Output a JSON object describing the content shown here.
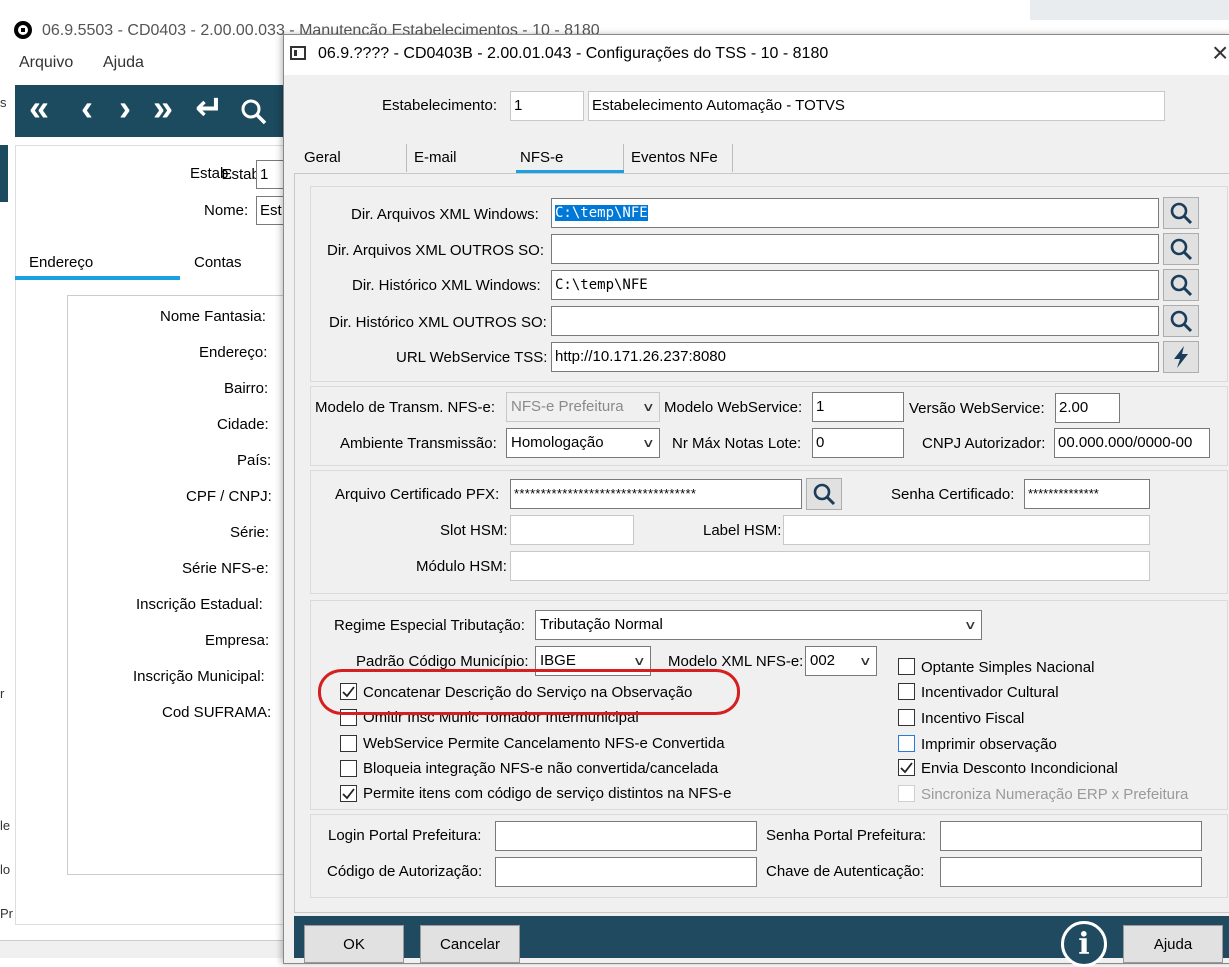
{
  "bg_window": {
    "title": "06.9.5503 - CD0403 - 2.00.00.033 - Manutenção Estabelecimentos - 10 - 8180",
    "menu": [
      "Arquivo",
      "Ajuda"
    ],
    "toolbar_glyphs": [
      "«",
      "‹",
      "›",
      "»",
      "↵"
    ],
    "estab_label": "Estab:",
    "estab_value": "1",
    "nome_label": "Nome:",
    "nome_value": "Est",
    "tabs": [
      "Endereço",
      "Contas"
    ],
    "fields": [
      "Nome Fantasia:",
      "Endereço:",
      "Bairro:",
      "Cidade:",
      "País:",
      "CPF / CNPJ:",
      "Série:",
      "Série NFS-e:",
      "Inscrição Estadual:",
      "Empresa:",
      "Inscrição Municipal:",
      "Cod SUFRAMA:"
    ],
    "edge_letters": [
      "s",
      "r",
      "le",
      "lo",
      "Pr"
    ]
  },
  "dialog": {
    "title": "06.9.???? - CD0403B - 2.00.01.043 - Configurações do TSS - 10 - 8180",
    "estab_label": "Estabelecimento:",
    "estab_code": "1",
    "estab_name": "Estabelecimento Automação - TOTVS",
    "tabs": [
      "Geral",
      "E-mail",
      "NFS-e",
      "Eventos NFe"
    ],
    "active_tab": "NFS-e",
    "dirs": [
      {
        "label": "Dir. Arquivos XML Windows:",
        "value": "C:\\temp\\NFE"
      },
      {
        "label": "Dir. Arquivos XML OUTROS SO:",
        "value": ""
      },
      {
        "label": "Dir. Histórico XML Windows:",
        "value": "C:\\temp\\NFE"
      },
      {
        "label": "Dir. Histórico XML OUTROS SO:",
        "value": ""
      },
      {
        "label": "URL WebService TSS:",
        "value": "http://10.171.26.237:8080"
      }
    ],
    "modelo_transm_label": "Modelo de Transm. NFS-e:",
    "modelo_transm_value": "NFS-e Prefeitura",
    "modelo_ws_label": "Modelo WebService:",
    "modelo_ws_value": "1",
    "versao_ws_label": "Versão WebService:",
    "versao_ws_value": "2.00",
    "ambiente_label": "Ambiente Transmissão:",
    "ambiente_value": "Homologação",
    "nrmax_label": "Nr Máx Notas Lote:",
    "nrmax_value": "0",
    "cnpj_label": "CNPJ Autorizador:",
    "cnpj_value": "00.000.000/0000-00",
    "cert_label": "Arquivo Certificado PFX:",
    "cert_value": "**********************************",
    "senha_cert_label": "Senha Certificado:",
    "senha_cert_value": "**************",
    "slot_label": "Slot HSM:",
    "label_hsm_label": "Label HSM:",
    "modulo_label": "Módulo HSM:",
    "regime_label": "Regime Especial Tributação:",
    "regime_value": "Tributação Normal",
    "padrao_label": "Padrão Código Município:",
    "padrao_value": "IBGE",
    "modelo_xml_label": "Modelo XML NFS-e:",
    "modelo_xml_value": "002",
    "left_checks": [
      {
        "label": "Concatenar Descrição do Serviço na Observação",
        "checked": true
      },
      {
        "label": "Omitir Insc Munic Tomador Intermunicipal",
        "checked": false
      },
      {
        "label": "WebService Permite Cancelamento NFS-e Convertida",
        "checked": false
      },
      {
        "label": "Bloqueia integração NFS-e não convertida/cancelada",
        "checked": false
      },
      {
        "label": "Permite itens com código de serviço distintos na NFS-e",
        "checked": true
      }
    ],
    "right_checks": [
      {
        "label": "Optante Simples Nacional",
        "checked": false
      },
      {
        "label": "Incentivador Cultural",
        "checked": false
      },
      {
        "label": "Incentivo Fiscal",
        "checked": false
      },
      {
        "label": "Imprimir observação",
        "checked": false
      },
      {
        "label": "Envia Desconto Incondicional",
        "checked": true
      },
      {
        "label": "Sincroniza Numeração ERP x Prefeitura",
        "checked": false
      }
    ],
    "login_label": "Login Portal Prefeitura:",
    "senha_portal_label": "Senha Portal Prefeitura:",
    "codigo_aut_label": "Código de Autorização:",
    "chave_aut_label": "Chave de Autenticação:",
    "ok_label": "OK",
    "cancel_label": "Cancelar",
    "help_label": "Ajuda",
    "info_glyph": "i",
    "close_glyph": "×"
  },
  "colors": {
    "toolbar": "#1c4a5e",
    "tab_underline": "#1ba1e2",
    "highlight_ring": "#d42020",
    "footer": "#1f4a5f",
    "selection": "#0078d7"
  }
}
